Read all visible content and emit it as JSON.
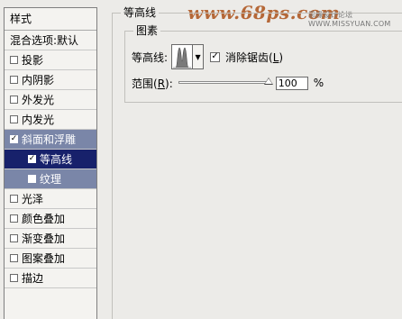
{
  "watermark": {
    "main": "www.68ps.com",
    "sub": "思缘设计论坛 WWW.MISSYUAN.COM"
  },
  "sidebar": {
    "header": "样式",
    "blend_options": "混合选项:默认",
    "items": [
      {
        "label": "投影",
        "checked": false
      },
      {
        "label": "内阴影",
        "checked": false
      },
      {
        "label": "外发光",
        "checked": false
      },
      {
        "label": "内发光",
        "checked": false
      },
      {
        "label": "斜面和浮雕",
        "checked": true
      },
      {
        "label": "等高线",
        "checked": true
      },
      {
        "label": "纹理",
        "checked": false
      },
      {
        "label": "光泽",
        "checked": false
      },
      {
        "label": "颜色叠加",
        "checked": false
      },
      {
        "label": "渐变叠加",
        "checked": false
      },
      {
        "label": "图案叠加",
        "checked": false
      },
      {
        "label": "描边",
        "checked": false
      }
    ]
  },
  "panel": {
    "section_title": "等高线",
    "group_title": "图素",
    "contour_label": "等高线:",
    "antialias_label": "消除锯齿(",
    "antialias_key": "L",
    "antialias_close": ")",
    "antialias_checked": true,
    "range_label": "范围(",
    "range_key": "R",
    "range_close": "):",
    "range_value": "100",
    "range_unit": "%",
    "range_fraction": 1.0
  },
  "colors": {
    "selected_dark": "#17216b",
    "selected_mid": "#7a86a8",
    "watermark": "#b3622f"
  }
}
